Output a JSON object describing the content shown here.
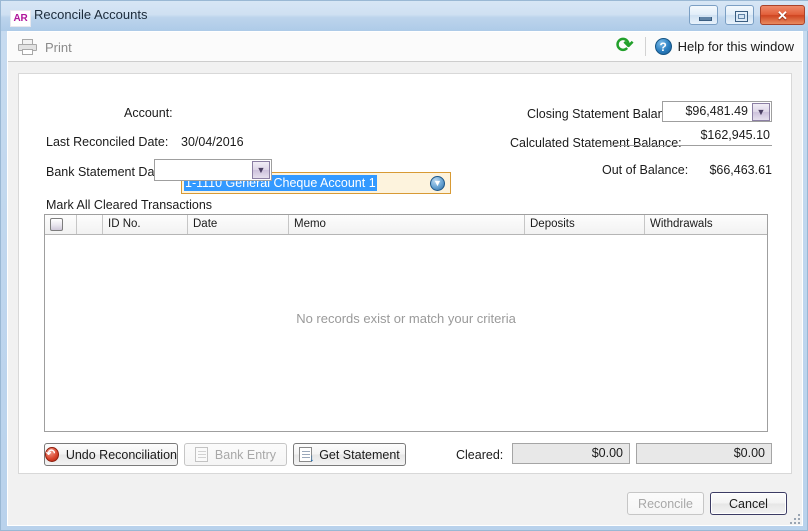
{
  "window": {
    "app_badge": "AR",
    "title": "Reconcile Accounts",
    "minimize_label": "–",
    "maximize_label": "□",
    "close_label": "✕"
  },
  "toolbar": {
    "print_label": "Print",
    "print_icon": "printer-icon",
    "refresh_icon": "refresh-icon",
    "refresh_glyph": "⟳",
    "refresh_color": "#22a02b",
    "help_icon": "help-circle-icon",
    "help_glyph": "?",
    "help_label": "Help for this window"
  },
  "form": {
    "account_label": "Account:",
    "account_value": "1-1110 General Cheque Account 1",
    "account_dropdown_glyph": "▼",
    "account_highlight_color": "#3399ff",
    "account_border_color": "#d89a34",
    "last_reconciled_label": "Last Reconciled Date:",
    "last_reconciled_value": "30/04/2016",
    "bank_statement_label": "Bank Statement Date:",
    "bank_statement_value": "",
    "bank_statement_placeholder": "",
    "date_chevron_glyph": "▼"
  },
  "balances": {
    "closing_label": "Closing Statement Balance:",
    "closing_value": "$96,481.49",
    "closing_chevron_glyph": "▼",
    "calculated_label": "Calculated Statement Balance:",
    "calculated_value": "$162,945.10",
    "out_of_balance_label": "Out of Balance:",
    "out_of_balance_value": "$66,463.61"
  },
  "grid": {
    "mark_all_label": "Mark All Cleared Transactions",
    "select_all_checkbox": "select-all-checkbox",
    "columns": [
      {
        "key": "check",
        "label": ""
      },
      {
        "key": "flag",
        "label": ""
      },
      {
        "key": "id_no",
        "label": "ID No."
      },
      {
        "key": "date",
        "label": "Date"
      },
      {
        "key": "memo",
        "label": "Memo"
      },
      {
        "key": "deposits",
        "label": "Deposits"
      },
      {
        "key": "withdrawals",
        "label": "Withdrawals"
      }
    ],
    "rows": [],
    "empty_message": "No records exist or match your criteria"
  },
  "actions": {
    "undo_label": "Undo Reconciliation",
    "undo_icon": "undo-circle-icon",
    "undo_glyph": "↶",
    "undo_color": "#d8422a",
    "bank_entry_label": "Bank Entry",
    "bank_entry_icon": "document-icon",
    "bank_entry_enabled": false,
    "get_statement_label": "Get Statement",
    "get_statement_icon": "document-download-icon",
    "get_statement_glyph": "↓",
    "cleared_label": "Cleared:",
    "cleared_deposits": "$0.00",
    "cleared_withdrawals": "$0.00"
  },
  "footer": {
    "reconcile_label": "Reconcile",
    "reconcile_enabled": false,
    "cancel_label": "Cancel"
  }
}
